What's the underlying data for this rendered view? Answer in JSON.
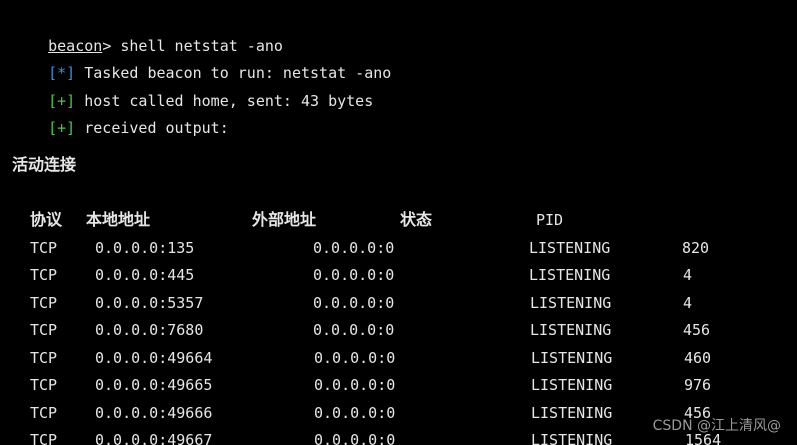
{
  "console": {
    "prompt_user": "beacon",
    "prompt_symbol": ">",
    "command": " shell netstat -ano",
    "lines": [
      {
        "tag": "[*]",
        "text": " Tasked beacon to run: netstat -ano"
      },
      {
        "tag": "[+]",
        "text": " host called home, sent: 43 bytes"
      },
      {
        "tag": "[+]",
        "text": " received output:"
      }
    ],
    "section_title": "活动连接"
  },
  "table": {
    "headers": {
      "proto": "协议",
      "local": "本地地址",
      "foreign": "外部地址",
      "state": "状态",
      "pid": "PID"
    },
    "rows": [
      {
        "proto": "TCP",
        "local": "0.0.0.0:135",
        "foreign": "0.0.0.0:0",
        "state": "LISTENING",
        "pid": "820"
      },
      {
        "proto": "TCP",
        "local": "0.0.0.0:445",
        "foreign": "0.0.0.0:0",
        "state": "LISTENING",
        "pid": "4"
      },
      {
        "proto": "TCP",
        "local": "0.0.0.0:5357",
        "foreign": "0.0.0.0:0",
        "state": "LISTENING",
        "pid": "4"
      },
      {
        "proto": "TCP",
        "local": "0.0.0.0:7680",
        "foreign": "0.0.0.0:0",
        "state": "LISTENING",
        "pid": "456"
      },
      {
        "proto": "TCP",
        "local": "0.0.0.0:49664",
        "foreign": "0.0.0.0:0",
        "state": "LISTENING",
        "pid": "460"
      },
      {
        "proto": "TCP",
        "local": "0.0.0.0:49665",
        "foreign": "0.0.0.0:0",
        "state": "LISTENING",
        "pid": "976"
      },
      {
        "proto": "TCP",
        "local": "0.0.0.0:49666",
        "foreign": "0.0.0.0:0",
        "state": "LISTENING",
        "pid": "456"
      },
      {
        "proto": "TCP",
        "local": "0.0.0.0:49667",
        "foreign": "0.0.0.0:0",
        "state": "LISTENING",
        "pid": "1564"
      }
    ]
  },
  "watermark": "CSDN @江上清风@",
  "colors": {
    "background": "#000000",
    "text": "#e6e6e6",
    "tag_star": "#3a8ddc",
    "tag_plus": "#49c649"
  }
}
